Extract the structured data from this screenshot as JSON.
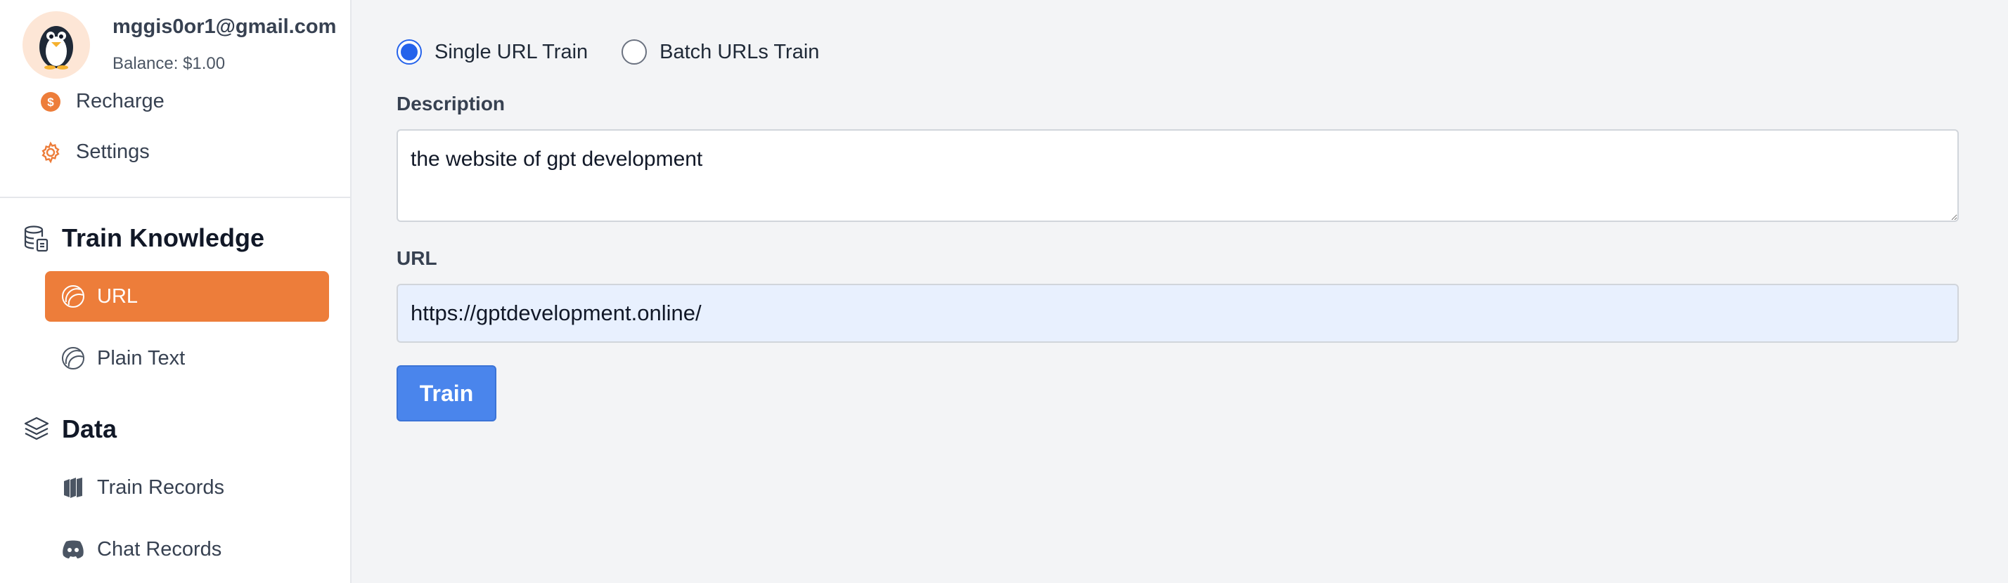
{
  "user": {
    "email": "mggis0or1@gmail.com",
    "balance": "Balance: $1.00"
  },
  "menu": {
    "recharge": "Recharge",
    "settings": "Settings"
  },
  "sections": {
    "train_knowledge": "Train Knowledge",
    "data": "Data"
  },
  "nav": {
    "url": "URL",
    "plain_text": "Plain Text",
    "train_records": "Train Records",
    "chat_records": "Chat Records"
  },
  "form": {
    "radio_single": "Single URL Train",
    "radio_batch": "Batch URLs Train",
    "selected_mode": "Single URL Train",
    "description_label": "Description",
    "description_value": "the website of gpt development",
    "url_label": "URL",
    "url_value": "https://gptdevelopment.online/",
    "train_button": "Train"
  },
  "colors": {
    "accent": "#ed7d3a",
    "primary": "#4a85ec",
    "radio_checked": "#2563eb"
  }
}
